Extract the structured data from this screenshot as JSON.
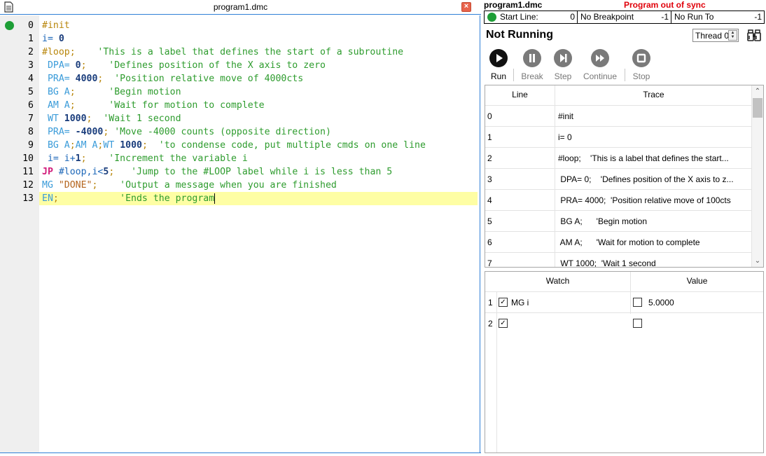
{
  "editor": {
    "title": "program1.dmc",
    "line_numbers": [
      "0",
      "1",
      "2",
      "3",
      "4",
      "5",
      "6",
      "7",
      "8",
      "9",
      "10",
      "11",
      "12",
      "13"
    ]
  },
  "code": [
    [
      {
        "t": "#init",
        "c": "label"
      }
    ],
    [
      {
        "t": "i= ",
        "c": "plain"
      },
      {
        "t": "0",
        "c": "num"
      }
    ],
    [
      {
        "t": "#loop;",
        "c": "label"
      },
      {
        "t": "    'This is a label that defines the start of a subroutine",
        "c": "cmt"
      }
    ],
    [
      {
        "t": " DPA= ",
        "c": "cmd"
      },
      {
        "t": "0",
        "c": "num"
      },
      {
        "t": ";",
        "c": "label"
      },
      {
        "t": "    'Defines position of the X axis to zero",
        "c": "cmt"
      }
    ],
    [
      {
        "t": " PRA= ",
        "c": "cmd"
      },
      {
        "t": "4000",
        "c": "num"
      },
      {
        "t": ";",
        "c": "label"
      },
      {
        "t": "  'Position relative move of 4000cts",
        "c": "cmt"
      }
    ],
    [
      {
        "t": " BG A",
        "c": "cmd"
      },
      {
        "t": ";",
        "c": "label"
      },
      {
        "t": "      'Begin motion",
        "c": "cmt"
      }
    ],
    [
      {
        "t": " AM A",
        "c": "cmd"
      },
      {
        "t": ";",
        "c": "label"
      },
      {
        "t": "      'Wait for motion to complete",
        "c": "cmt"
      }
    ],
    [
      {
        "t": " WT ",
        "c": "cmd"
      },
      {
        "t": "1000",
        "c": "num"
      },
      {
        "t": ";",
        "c": "label"
      },
      {
        "t": "  'Wait 1 second",
        "c": "cmt"
      }
    ],
    [
      {
        "t": " PRA= ",
        "c": "cmd"
      },
      {
        "t": "-4000",
        "c": "num"
      },
      {
        "t": ";",
        "c": "label"
      },
      {
        "t": " 'Move -4000 counts (opposite direction)",
        "c": "cmt"
      }
    ],
    [
      {
        "t": " BG A",
        "c": "cmd"
      },
      {
        "t": ";",
        "c": "label"
      },
      {
        "t": "AM A",
        "c": "cmd"
      },
      {
        "t": ";",
        "c": "label"
      },
      {
        "t": "WT ",
        "c": "cmd"
      },
      {
        "t": "1000",
        "c": "num"
      },
      {
        "t": ";",
        "c": "label"
      },
      {
        "t": "  'to condense code, put multiple cmds on one line",
        "c": "cmt"
      }
    ],
    [
      {
        "t": " i= i+",
        "c": "plain"
      },
      {
        "t": "1",
        "c": "num"
      },
      {
        "t": ";",
        "c": "label"
      },
      {
        "t": "    'Increment the variable i",
        "c": "cmt"
      }
    ],
    [
      {
        "t": "JP",
        "c": "kw"
      },
      {
        "t": " #loop,i<",
        "c": "plain"
      },
      {
        "t": "5",
        "c": "num"
      },
      {
        "t": ";",
        "c": "label"
      },
      {
        "t": "   'Jump to the #LOOP label while i is less than 5",
        "c": "cmt"
      }
    ],
    [
      {
        "t": "MG ",
        "c": "cmd"
      },
      {
        "t": "\"DONE\"",
        "c": "str"
      },
      {
        "t": ";",
        "c": "label"
      },
      {
        "t": "    'Output a message when you are finished",
        "c": "cmt"
      }
    ],
    [
      {
        "t": "EN",
        "c": "cmd"
      },
      {
        "t": ";",
        "c": "label"
      },
      {
        "t": "           'Ends the program",
        "c": "cmt"
      }
    ]
  ],
  "debugger": {
    "program_name": "program1.dmc",
    "sync_status": "Program out of sync",
    "start_line_label": "Start Line:",
    "start_line_value": "0",
    "breakpoint_label": "No Breakpoint",
    "breakpoint_value": "-1",
    "run_to_label": "No Run To",
    "run_to_value": "-1",
    "state": "Not Running",
    "thread": "Thread 0",
    "toolbar": {
      "run": "Run",
      "break": "Break",
      "step": "Step",
      "continue": "Continue",
      "stop": "Stop"
    },
    "trace": {
      "headers": [
        "Line",
        "Trace"
      ],
      "rows": [
        [
          "0",
          "#init"
        ],
        [
          "1",
          "i= 0"
        ],
        [
          "2",
          "#loop;    'This is a label that defines the start..."
        ],
        [
          "3",
          " DPA= 0;    'Defines position of the X axis to z..."
        ],
        [
          "4",
          " PRA= 4000;  'Position relative move of 100cts"
        ],
        [
          "5",
          " BG A;      'Begin motion"
        ],
        [
          "6",
          " AM A;      'Wait for motion to complete"
        ],
        [
          "7",
          " WT 1000;  'Wait 1 second"
        ]
      ]
    },
    "watch": {
      "headers": [
        "Watch",
        "Value"
      ],
      "rows": [
        {
          "index": "1",
          "enabled": true,
          "expr": "MG i",
          "value_checked": false,
          "value": "5.0000"
        },
        {
          "index": "2",
          "enabled": true,
          "expr": "",
          "value_checked": false,
          "value": ""
        }
      ]
    }
  },
  "colors": {
    "accent": "#2f7fd6",
    "breakpoint": "#1d9e36",
    "error": "#e0000a",
    "highlight": "#fefea4"
  }
}
